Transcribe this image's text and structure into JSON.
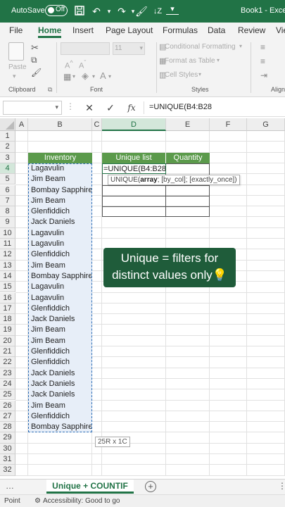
{
  "titlebar": {
    "autosave_label": "AutoSave",
    "toggle_state": "Off",
    "doc_title": "Book1 - Exce"
  },
  "ribbon_tabs": [
    "File",
    "Home",
    "Insert",
    "Page Layout",
    "Formulas",
    "Data",
    "Review",
    "Vie"
  ],
  "ribbon": {
    "paste_label": "Paste",
    "clipboard_label": "Clipboard",
    "font_label": "Font",
    "font_size": "11",
    "conditional_formatting": "Conditional Formatting",
    "format_as_table": "Format as Table",
    "cell_styles": "Cell Styles",
    "styles_label": "Styles",
    "alignment_label": "Align"
  },
  "formula_bar": {
    "formula": "=UNIQUE(B4:B28",
    "fx_label": "fx"
  },
  "columns": [
    "A",
    "B",
    "C",
    "D",
    "E",
    "F",
    "G"
  ],
  "rows": [
    "1",
    "2",
    "3",
    "4",
    "5",
    "6",
    "7",
    "8",
    "9",
    "10",
    "11",
    "12",
    "13",
    "14",
    "15",
    "16",
    "17",
    "18",
    "19",
    "20",
    "21",
    "22",
    "23",
    "24",
    "25",
    "26",
    "27",
    "28",
    "29",
    "30",
    "31",
    "32"
  ],
  "sheet": {
    "inventory_header": "Inventory",
    "unique_header": "Unique list",
    "quantity_header": "Quantity",
    "editing_formula": "=UNIQUE(B4:B28",
    "tooltip_fn": "UNIQUE(",
    "tooltip_arg": "array",
    "tooltip_rest": "; [by_col]; [exactly_once])",
    "dimension_label": "25R x 1C",
    "inventory": [
      "Lagavulin",
      "Jim Beam",
      "Bombay Sapphire",
      "Jim Beam",
      "Glenfiddich",
      "Jack Daniels",
      "Lagavulin",
      "Lagavulin",
      "Glenfiddich",
      "Jim Beam",
      "Bombay Sapphire",
      "Lagavulin",
      "Lagavulin",
      "Glenfiddich",
      "Jack Daniels",
      "Jim Beam",
      "Jim Beam",
      "Glenfiddich",
      "Glenfiddich",
      "Jack Daniels",
      "Jack Daniels",
      "Jack Daniels",
      "Jim Beam",
      "Glenfiddich",
      "Bombay Sapphire"
    ]
  },
  "callout": {
    "line1": "Unique = filters for",
    "line2": "distinct values only💡"
  },
  "sheet_tabs": {
    "active": "Unique + COUNTIF"
  },
  "status": {
    "mode": "Point",
    "accessibility": "Accessibility: Good to go"
  },
  "colors": {
    "excel_green": "#217346",
    "header_green": "#5b9a4b",
    "callout_bg": "#1f5c3a",
    "selection_blue": "#2b6cb5"
  }
}
